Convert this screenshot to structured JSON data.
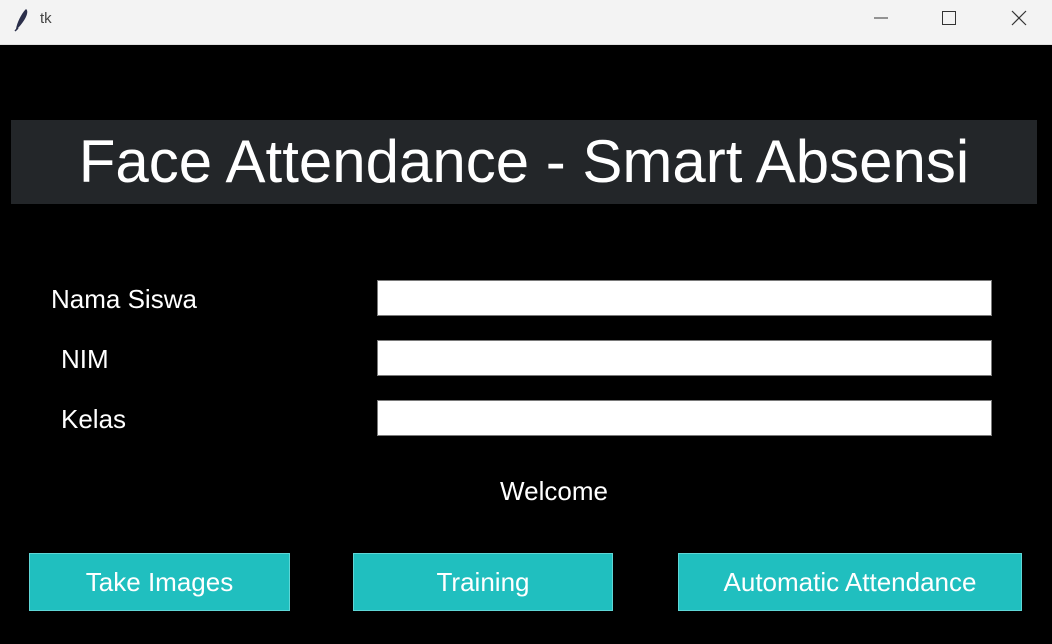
{
  "window": {
    "title": "tk",
    "icon": "tk-feather-icon",
    "controls": {
      "minimize": "minimize-icon",
      "maximize": "maximize-icon",
      "close": "close-icon"
    }
  },
  "header": {
    "title": "Face Attendance - Smart Absensi"
  },
  "form": {
    "fields": [
      {
        "label": "Nama Siswa",
        "value": ""
      },
      {
        "label": "NIM",
        "value": ""
      },
      {
        "label": "Kelas",
        "value": ""
      }
    ]
  },
  "status": {
    "message": "Welcome"
  },
  "actions": {
    "take_images": "Take Images",
    "training": "Training",
    "automatic_attendance": "Automatic Attendance"
  },
  "colors": {
    "background": "#000000",
    "header_bg": "#232629",
    "button_bg": "#20bfbf",
    "text": "#ffffff"
  }
}
